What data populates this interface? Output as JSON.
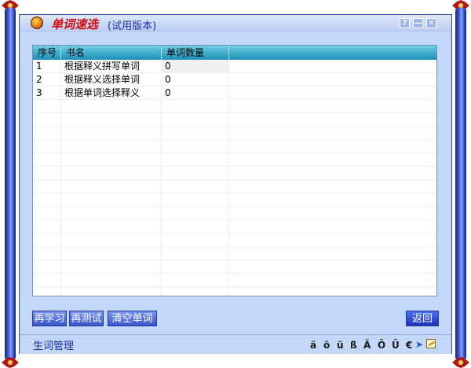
{
  "window": {
    "app_name": "单词速选",
    "edition": "(试用版本)",
    "title_buttons": {
      "help": "?",
      "minimize": "—",
      "close": "✕"
    }
  },
  "table": {
    "columns": [
      "序号",
      "书名",
      "单词数量"
    ],
    "rows": [
      {
        "index": "1",
        "name": "根据释义拼写单词",
        "count": "0"
      },
      {
        "index": "2",
        "name": "根据释义选择单词",
        "count": "0"
      },
      {
        "index": "3",
        "name": "根据单词选择释义",
        "count": "0"
      }
    ]
  },
  "buttons": {
    "relearn": "再学习",
    "retest": "再测试",
    "clear": "清空单词",
    "back": "返回"
  },
  "status": {
    "label": "生词管理",
    "special_chars": [
      "ä",
      "ö",
      "ü",
      "ß",
      "Ä",
      "Ö",
      "Ü",
      "€"
    ]
  },
  "colors": {
    "window_bg": "#c3d7f8",
    "header_start": "#6ecfe4",
    "header_end": "#1b8fb6",
    "brand_text": "#d40a0a",
    "accent_text": "#1b2ea8"
  },
  "icons": [
    "app-logo-icon",
    "help-icon",
    "minimize-icon",
    "close-icon",
    "arrow-right-icon",
    "note-edit-icon"
  ]
}
